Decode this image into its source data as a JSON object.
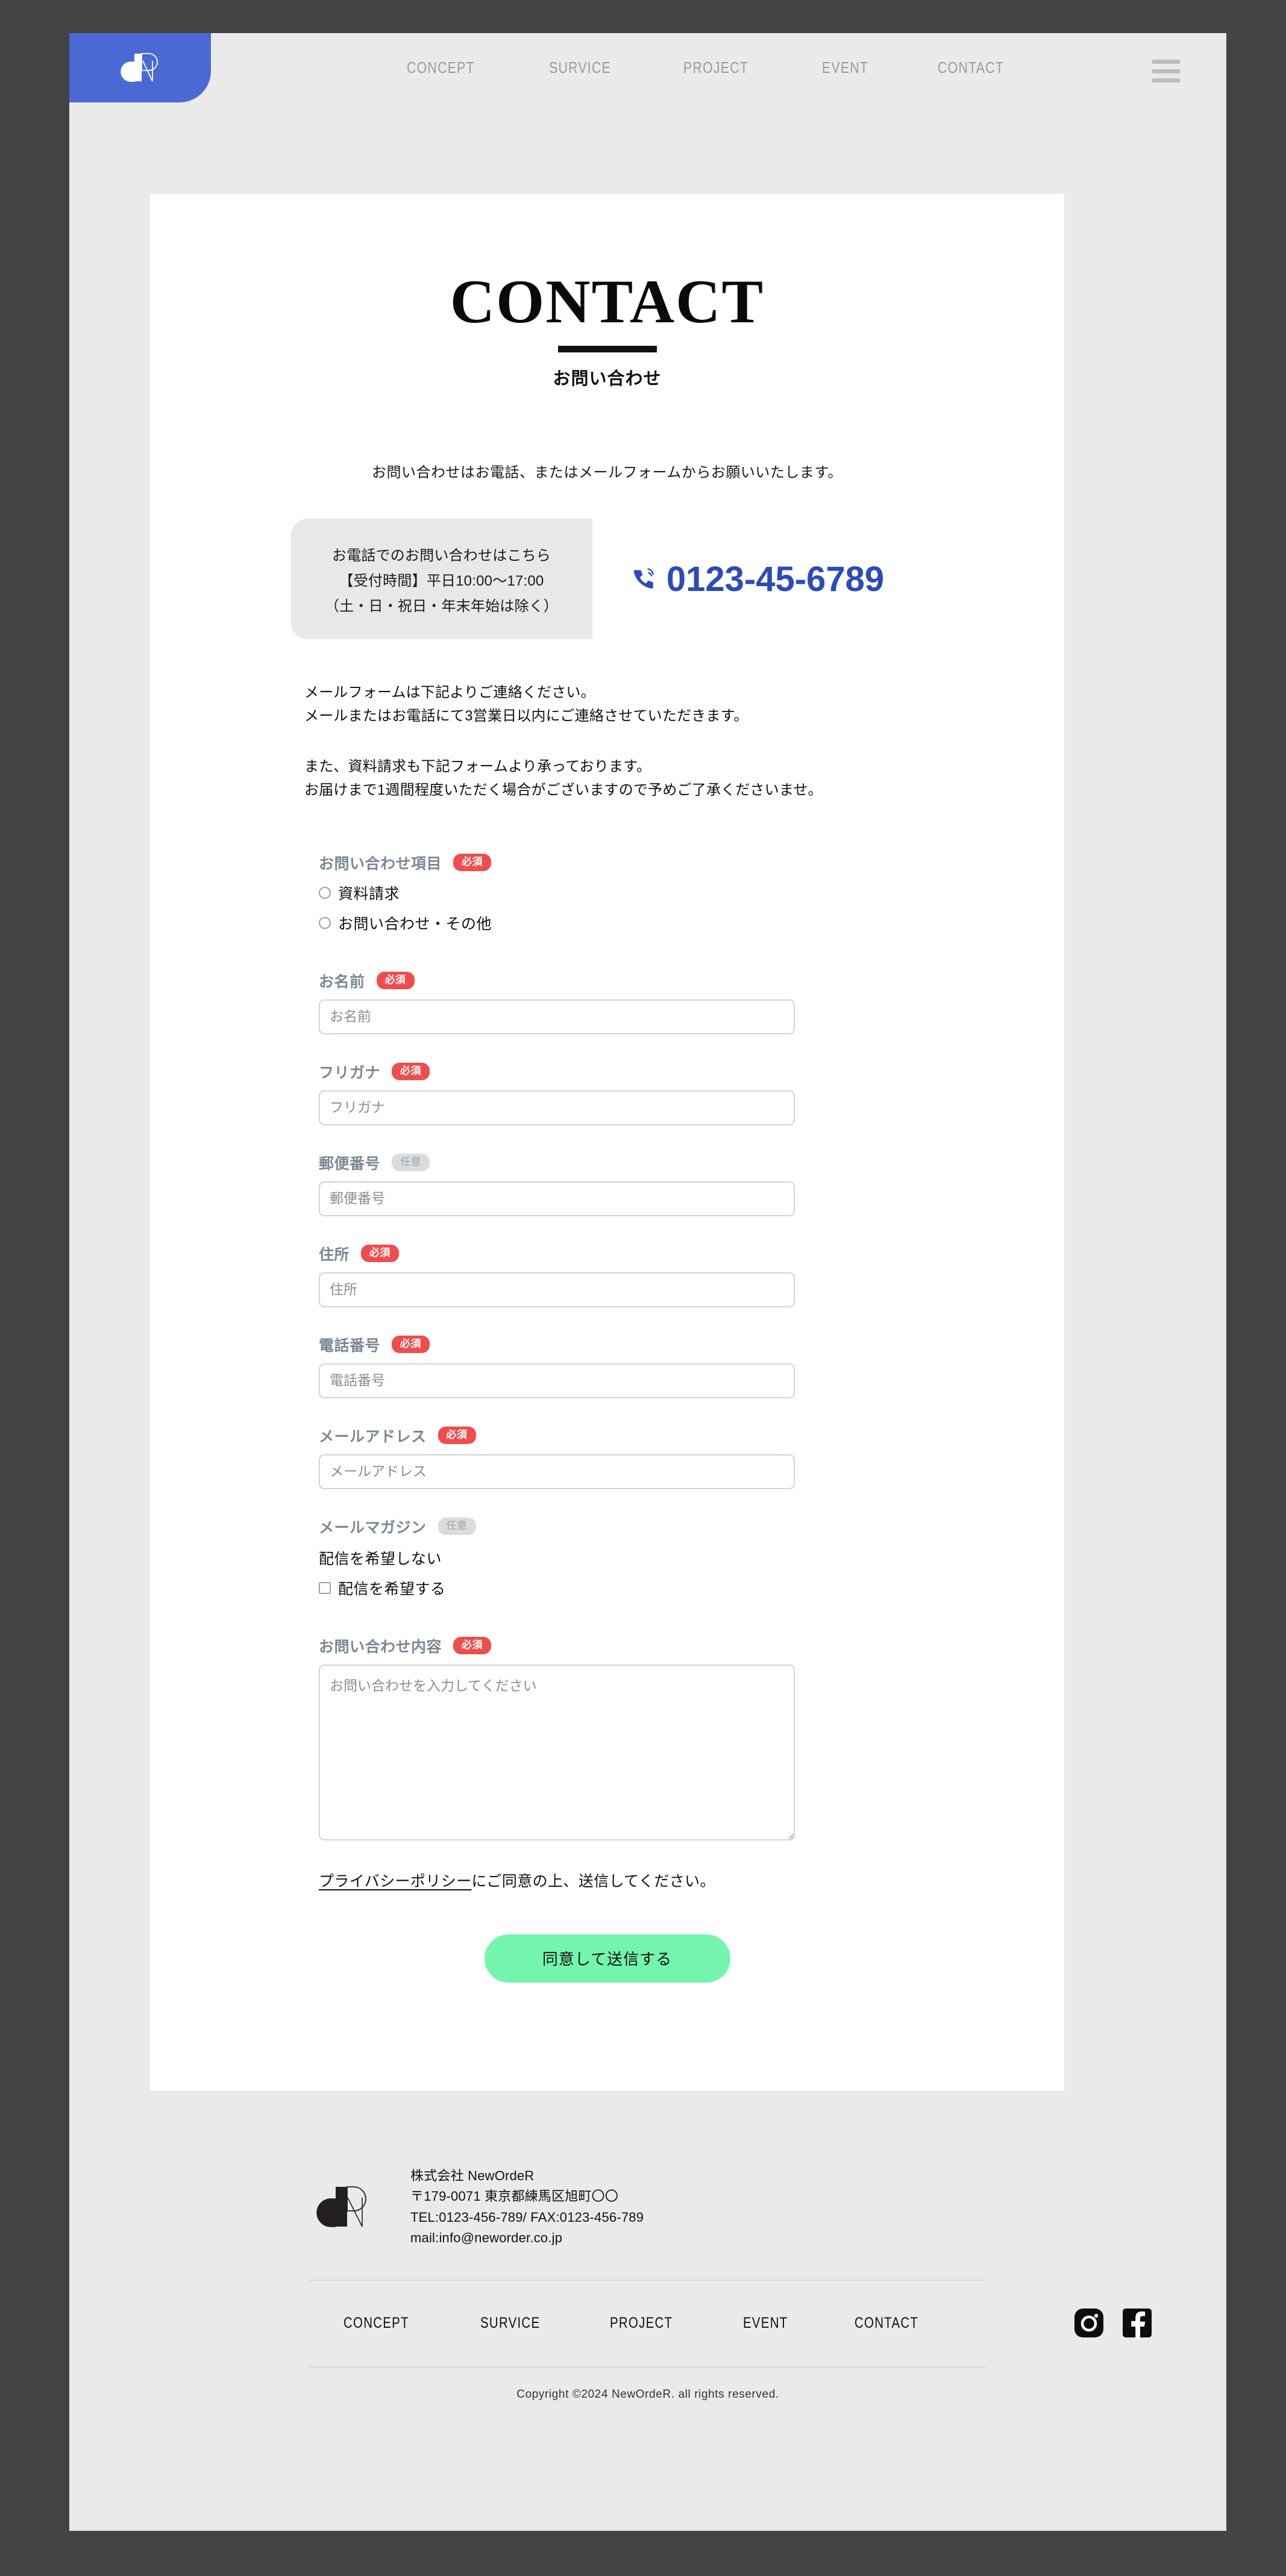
{
  "header": {
    "logo_alt": "dR",
    "nav": [
      {
        "label": "CONCEPT"
      },
      {
        "label": "SURVICE"
      },
      {
        "label": "PROJECT"
      },
      {
        "label": "EVENT"
      },
      {
        "label": "CONTACT"
      }
    ]
  },
  "hero": {
    "title": "CONTACT",
    "subtitle": "お問い合わせ",
    "lead": "お問い合わせはお電話、またはメールフォームからお願いいたします。"
  },
  "phone_box": {
    "line1": "お電話でのお問い合わせはこちら",
    "line2": "【受付時間】平日10:00〜17:00",
    "line3": "（土・日・祝日・年末年始は除く）",
    "number": "0123-45-6789"
  },
  "body": {
    "para1_line1": "メールフォームは下記よりご連絡ください。",
    "para1_line2": "メールまたはお電話にて3営業日以内にご連絡させていただきます。",
    "para2_line1": "また、資料請求も下記フォームより承っております。",
    "para2_line2": "お届けまで1週間程度いただく場合がございますので予めご了承くださいませ。"
  },
  "form": {
    "badge_required": "必須",
    "badge_optional": "任意",
    "inquiry_type": {
      "label": "お問い合わせ項目",
      "options": [
        "資料請求",
        "お問い合わせ・その他"
      ]
    },
    "name": {
      "label": "お名前",
      "placeholder": "お名前",
      "value": ""
    },
    "furigana": {
      "label": "フリガナ",
      "placeholder": "フリガナ",
      "value": ""
    },
    "postal": {
      "label": "郵便番号",
      "placeholder": "郵便番号",
      "value": ""
    },
    "address": {
      "label": "住所",
      "placeholder": "住所",
      "value": ""
    },
    "tel": {
      "label": "電話番号",
      "placeholder": "電話番号",
      "value": ""
    },
    "email": {
      "label": "メールアドレス",
      "placeholder": "メールアドレス",
      "value": ""
    },
    "magazine": {
      "label": "メールマガジン",
      "option_no": "配信を希望しない",
      "option_yes": "配信を希望する"
    },
    "message": {
      "label": "お問い合わせ内容",
      "placeholder": "お問い合わせを入力してください",
      "value": ""
    },
    "privacy_link": "プライバシーポリシー",
    "privacy_rest": "にご同意の上、送信してください。",
    "submit_label": "同意して送信する"
  },
  "footer": {
    "company": "株式会社 NewOrdeR",
    "address": "〒179-0071 東京都練馬区旭町〇〇",
    "tel_fax": "TEL:0123-456-789/ FAX:0123-456-789",
    "mail": "mail:info@neworder.co.jp",
    "nav": [
      {
        "label": "CONCEPT"
      },
      {
        "label": "SURVICE"
      },
      {
        "label": "PROJECT"
      },
      {
        "label": "EVENT"
      },
      {
        "label": "CONTACT"
      }
    ],
    "social": [
      {
        "name": "instagram"
      },
      {
        "name": "facebook"
      }
    ],
    "copyright": "Copyright ©2024 NewOrdeR. all rights reserved."
  },
  "colors": {
    "logo_blue": "#4a69d4",
    "phone_blue": "#2b4bb8",
    "badge_red": "#ef4d4d",
    "badge_grey": "#dcdcdc",
    "submit_green": "#74f5ad",
    "page_bg": "#eaeaea",
    "outer_bg": "#444444"
  }
}
